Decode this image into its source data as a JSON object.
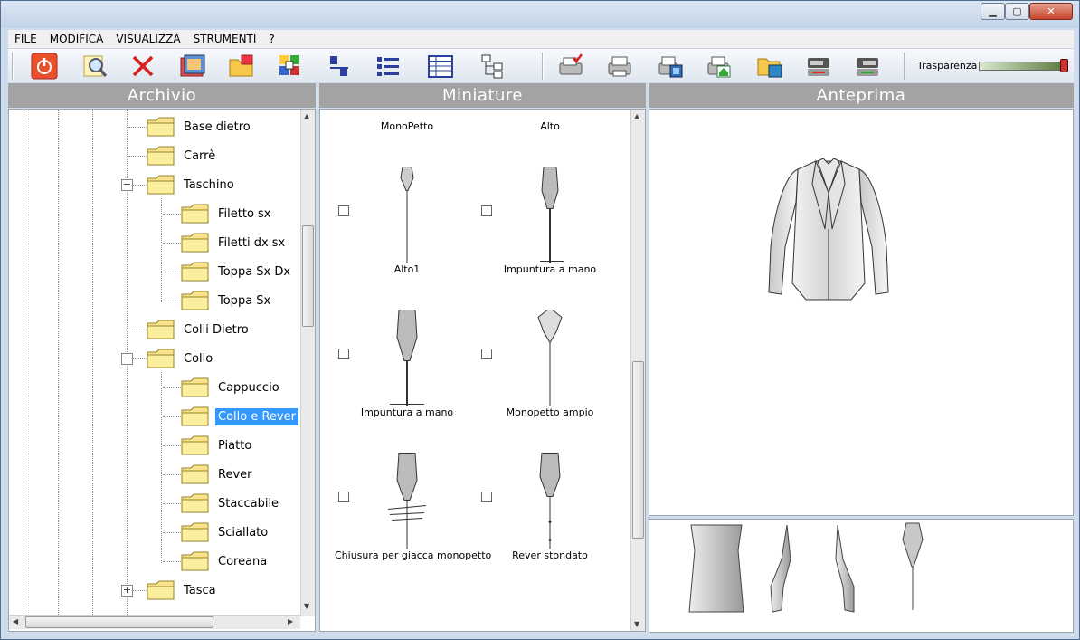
{
  "menu": [
    "FILE",
    "MODIFICA",
    "VISUALIZZA",
    "STRUMENTI",
    "?"
  ],
  "toolbar": {
    "buttons": [
      "power-icon",
      "search-icon",
      "delete-icon",
      "gallery-icon",
      "open-folder-icon",
      "palette-icon",
      "sort-icon",
      "list-icon",
      "table-icon",
      "tree-icon",
      "print-check-icon",
      "print-icon",
      "print-preview-icon",
      "print-home-icon",
      "export-icon",
      "import-left-icon",
      "import-right-icon"
    ],
    "transparency_label": "Trasparenza"
  },
  "panes": {
    "archivio": "Archivio",
    "miniature": "Miniature",
    "anteprima": "Anteprima"
  },
  "tree": {
    "items": [
      {
        "label": "Base dietro",
        "level": 1
      },
      {
        "label": "Carrè",
        "level": 1
      },
      {
        "label": "Taschino",
        "level": 1,
        "expander": "−"
      },
      {
        "label": "Filetto sx",
        "level": 2
      },
      {
        "label": "Filetti dx sx",
        "level": 2
      },
      {
        "label": "Toppa Sx Dx",
        "level": 2
      },
      {
        "label": "Toppa Sx",
        "level": 2
      },
      {
        "label": "Colli Dietro",
        "level": 1
      },
      {
        "label": "Collo",
        "level": 1,
        "expander": "−"
      },
      {
        "label": "Cappuccio",
        "level": 2
      },
      {
        "label": "Collo e Rever",
        "level": 2,
        "selected": true
      },
      {
        "label": "Piatto",
        "level": 2
      },
      {
        "label": "Rever",
        "level": 2
      },
      {
        "label": "Staccabile",
        "level": 2
      },
      {
        "label": "Sciallato",
        "level": 2
      },
      {
        "label": "Coreana",
        "level": 2
      },
      {
        "label": "Tasca",
        "level": 1,
        "expander": "+"
      }
    ]
  },
  "thumbnails": {
    "top_labels": [
      "MonoPetto",
      "Alto"
    ],
    "cells": [
      {
        "label": "Alto1"
      },
      {
        "label": "Impuntura a mano"
      },
      {
        "label": "Impuntura a mano"
      },
      {
        "label": "Monopetto ampio"
      },
      {
        "label": "Chiusura per giacca monopetto"
      },
      {
        "label": "Rever stondato"
      }
    ]
  },
  "colors": {
    "header_bg": "#a3a3a3",
    "selection": "#3399ff"
  }
}
